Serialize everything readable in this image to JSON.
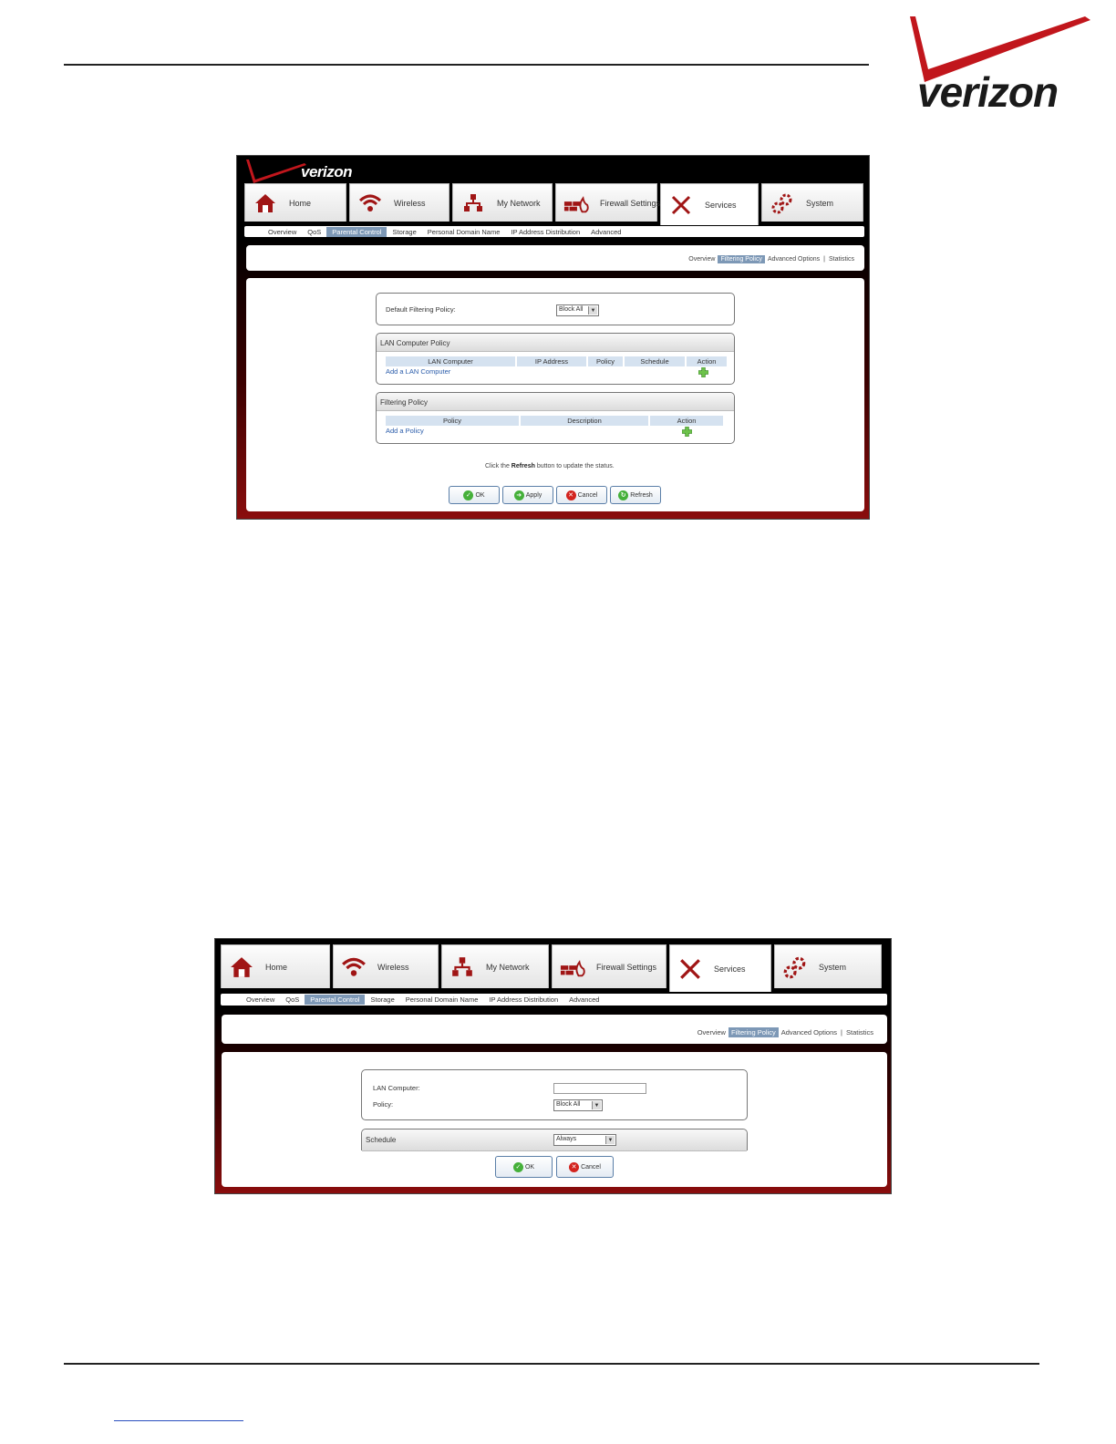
{
  "page_logo": {
    "text": "verizon"
  },
  "screenshot1": {
    "brand": "verizon",
    "tabs": [
      {
        "label": "Home",
        "icon": "home-icon"
      },
      {
        "label": "Wireless",
        "icon": "wifi-icon"
      },
      {
        "label": "My Network",
        "icon": "network-icon"
      },
      {
        "label": "Firewall Settings",
        "icon": "firewall-icon"
      },
      {
        "label": "Services",
        "icon": "services-icon"
      },
      {
        "label": "System",
        "icon": "gears-icon"
      }
    ],
    "subnav": [
      "Overview",
      "QoS",
      "Parental Control",
      "Storage",
      "Personal Domain Name",
      "IP Address Distribution",
      "Advanced"
    ],
    "subnav_active": "Parental Control",
    "secnav": [
      "Overview",
      "Filtering Policy",
      "Advanced Options",
      "Statistics"
    ],
    "secnav_sep": "|",
    "default_policy": {
      "label": "Default Filtering Policy:",
      "value": "Block All"
    },
    "lan_policy": {
      "title": "LAN Computer Policy",
      "columns": [
        "LAN Computer",
        "IP Address",
        "Policy",
        "Schedule",
        "Action"
      ],
      "add_link": "Add a LAN Computer"
    },
    "filtering_policy": {
      "title": "Filtering Policy",
      "columns": [
        "Policy",
        "Description",
        "Action"
      ],
      "add_link": "Add a Policy"
    },
    "note": {
      "pre": "Click the",
      "bold": "Refresh",
      "post": "button to update the status."
    },
    "buttons": [
      "OK",
      "Apply",
      "Cancel",
      "Refresh"
    ]
  },
  "screenshot2": {
    "tabs": [
      {
        "label": "Home",
        "icon": "home-icon"
      },
      {
        "label": "Wireless",
        "icon": "wifi-icon"
      },
      {
        "label": "My Network",
        "icon": "network-icon"
      },
      {
        "label": "Firewall Settings",
        "icon": "firewall-icon"
      },
      {
        "label": "Services",
        "icon": "services-icon"
      },
      {
        "label": "System",
        "icon": "gears-icon"
      }
    ],
    "subnav": [
      "Overview",
      "QoS",
      "Parental Control",
      "Storage",
      "Personal Domain Name",
      "IP Address Distribution",
      "Advanced"
    ],
    "subnav_active": "Parental Control",
    "secnav": [
      "Overview",
      "Filtering Policy",
      "Advanced Options",
      "Statistics"
    ],
    "secnav_sep": "|",
    "lan_computer_label": "LAN Computer:",
    "lan_computer_value": "",
    "policy_label": "Policy:",
    "policy_value": "Block All",
    "schedule_label": "Schedule",
    "schedule_value": "Always",
    "buttons": [
      "OK",
      "Cancel"
    ]
  },
  "colors": {
    "brand_red": "#c1161c",
    "accent_blue": "#7d98b6",
    "link_blue": "#2a5caa"
  }
}
